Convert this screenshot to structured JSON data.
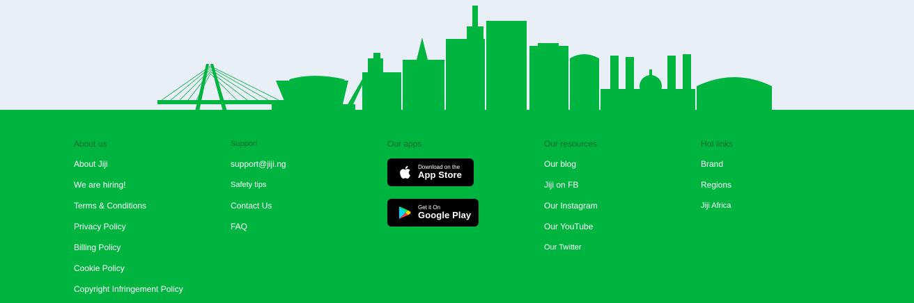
{
  "colors": {
    "brand_green": "#00b53f",
    "sky": "#e8eff6",
    "heading": "#0f6b2c"
  },
  "illustration": {
    "name": "city-skyline-illustration"
  },
  "footer": {
    "about": {
      "heading": "About us",
      "links": [
        "About Jiji",
        "We are hiring!",
        "Terms & Conditions",
        "Privacy Policy",
        "Billing Policy",
        "Cookie Policy",
        "Copyright Infringement Policy"
      ]
    },
    "support": {
      "heading": "Support",
      "links": [
        "support@jiji.ng",
        "Safety tips",
        "Contact Us",
        "FAQ"
      ]
    },
    "apps": {
      "heading": "Our apps",
      "app_store": {
        "small": "Download on the",
        "big": "App Store",
        "icon": "apple-icon"
      },
      "google_play": {
        "small": "Get it On",
        "big": "Google Play",
        "icon": "google-play-icon"
      }
    },
    "resources": {
      "heading": "Our resources",
      "links": [
        "Our blog",
        "Jiji on FB",
        "Our Instagram",
        "Our YouTube",
        "Our Twitter"
      ]
    },
    "hotlinks": {
      "heading": "Hot links",
      "links": [
        "Brand",
        "Regions",
        "Jiji Africa"
      ]
    }
  }
}
